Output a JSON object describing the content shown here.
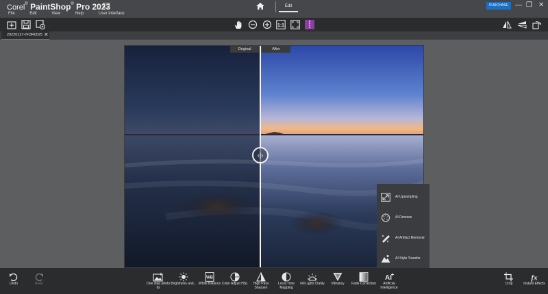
{
  "app": {
    "brand_corel": "Corel",
    "brand_reg": "®",
    "brand_main": "PaintShop",
    "brand_reg2": "®",
    "brand_pro": " Pro",
    "brand_year": " 2023"
  },
  "menu": [
    "File",
    "Edit",
    "View",
    "Help",
    "User Interface"
  ],
  "tabs": {
    "edit": "Edit"
  },
  "purchase_label": "PURCHASE",
  "window_controls": {
    "minimize": "—",
    "restore": "❐",
    "close": "✕"
  },
  "file_tab": {
    "name": "20220127-IVOR0025",
    "close": "✕"
  },
  "compare": {
    "original": "Original",
    "after": "After",
    "handle": "‹|›"
  },
  "ai_menu": [
    {
      "label": "AI Upsampling",
      "icon": "ai-upsampling-icon"
    },
    {
      "label": "AI Denoise",
      "icon": "ai-denoise-icon"
    },
    {
      "label": "AI Artifact Removal",
      "icon": "ai-artifact-removal-icon"
    },
    {
      "label": "AI Style Transfer",
      "icon": "ai-style-transfer-icon"
    }
  ],
  "bottom": {
    "undo": "Undo",
    "redo": "Redo",
    "tools": [
      "One step photo fix",
      "Brightness and...",
      "White Balance",
      "Color Adjust HSL",
      "High Pass Sharpen",
      "Local Tone Mapping",
      "Fill Light/ Clarity",
      "Vibrancy",
      "Fade Correction",
      "Artificial Intelligence"
    ],
    "crop": "Crop",
    "instant_effects": "Instant Effects",
    "ai_icon_text": "AI",
    "wb_icon_text": "WB",
    "fx_icon_text": "fx"
  },
  "colors": {
    "accent_blue": "#1e6fbf",
    "active_tab_line": "#2a88d8",
    "toolbar_bg": "#2b2c2e",
    "workspace_bg": "#5d5e60",
    "compare_icon": "#8a3fa0"
  }
}
